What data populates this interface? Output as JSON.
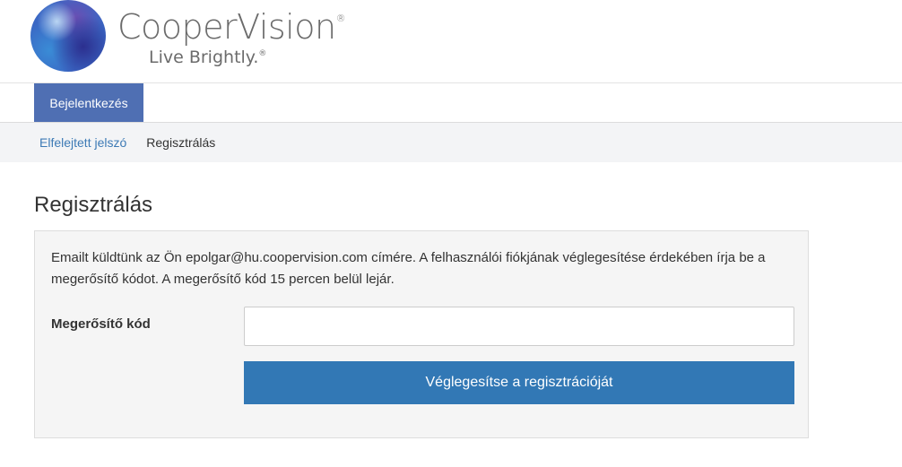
{
  "brand": {
    "name": "CooperVision",
    "name_mark": "®",
    "tagline": "Live Brightly.",
    "tagline_mark": "®"
  },
  "nav": {
    "tabs": [
      {
        "label": "Bejelentkezés",
        "active": true
      }
    ]
  },
  "subnav": {
    "forgot_password": "Elfelejtett jelszó",
    "register": "Regisztrálás"
  },
  "main": {
    "title": "Regisztrálás",
    "message": "Emailt küldtünk az Ön epolgar@hu.coopervision.com címére. A felhasználói fiókjának véglegesítése érdekében írja be a megerősítő kódot. A megerősítő kód 15 percen belül lejár.",
    "code_label": "Megerősítő kód",
    "code_value": "",
    "submit_label": "Véglegesítse a regisztrációját"
  },
  "colors": {
    "tab_active": "#4f6fb3",
    "button": "#3278b5",
    "link": "#3d7ab5"
  }
}
